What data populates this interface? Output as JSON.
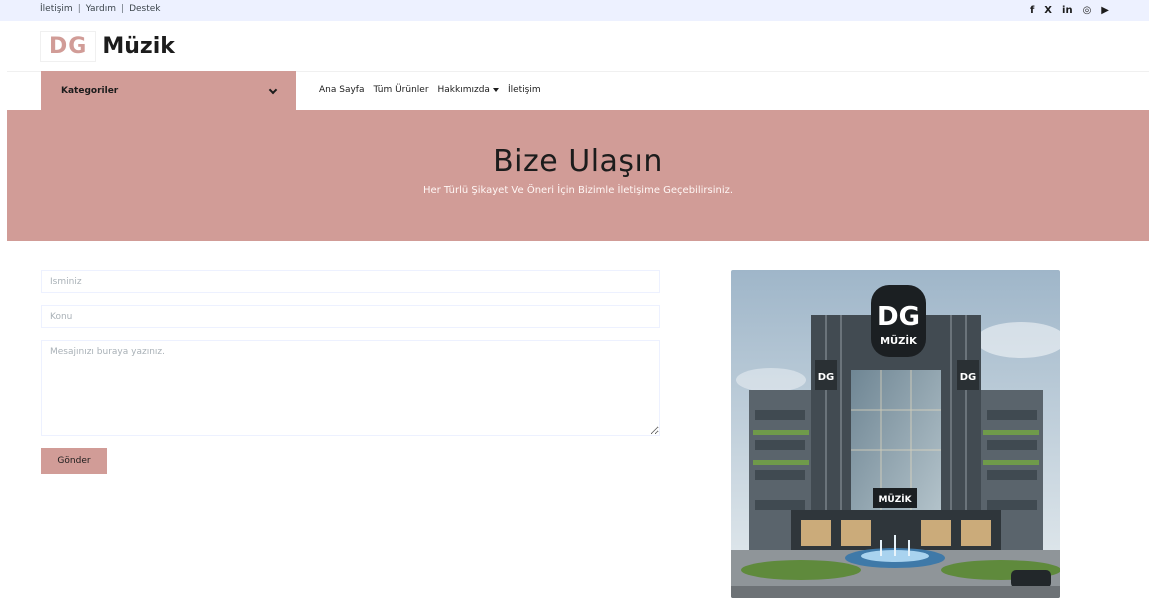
{
  "topbar": {
    "links": [
      "İletişim",
      "Yardım",
      "Destek"
    ],
    "social_icons": [
      "facebook-icon",
      "x-icon",
      "linkedin-icon",
      "instagram-icon",
      "youtube-icon"
    ],
    "social_glyphs": [
      "f",
      "X",
      "in",
      "◎",
      "▶"
    ]
  },
  "logo": {
    "prefix": "DG",
    "name": "Müzik"
  },
  "nav": {
    "categories_label": "Kategoriler",
    "links": [
      "Ana Sayfa",
      "Tüm Ürünler",
      "Hakkımızda",
      "İletişim"
    ]
  },
  "hero": {
    "title": "Bize Ulaşın",
    "subtitle": "Her Türlü Şikayet Ve Öneri İçin Bizimle İletişime Geçebilirsiniz."
  },
  "form": {
    "name_placeholder": "İsminiz",
    "subject_placeholder": "Konu",
    "message_placeholder": "Mesajınızı buraya yazınız.",
    "submit_label": "Gönder"
  },
  "image": {
    "sign_top": "DG",
    "sign_bottom": "MÜZİK",
    "storefront_sign": "MÜZİK",
    "side_sign": "DG"
  },
  "colors": {
    "accent": "#d19c97",
    "topbar": "#edf1ff",
    "text": "#1c1c1c"
  }
}
